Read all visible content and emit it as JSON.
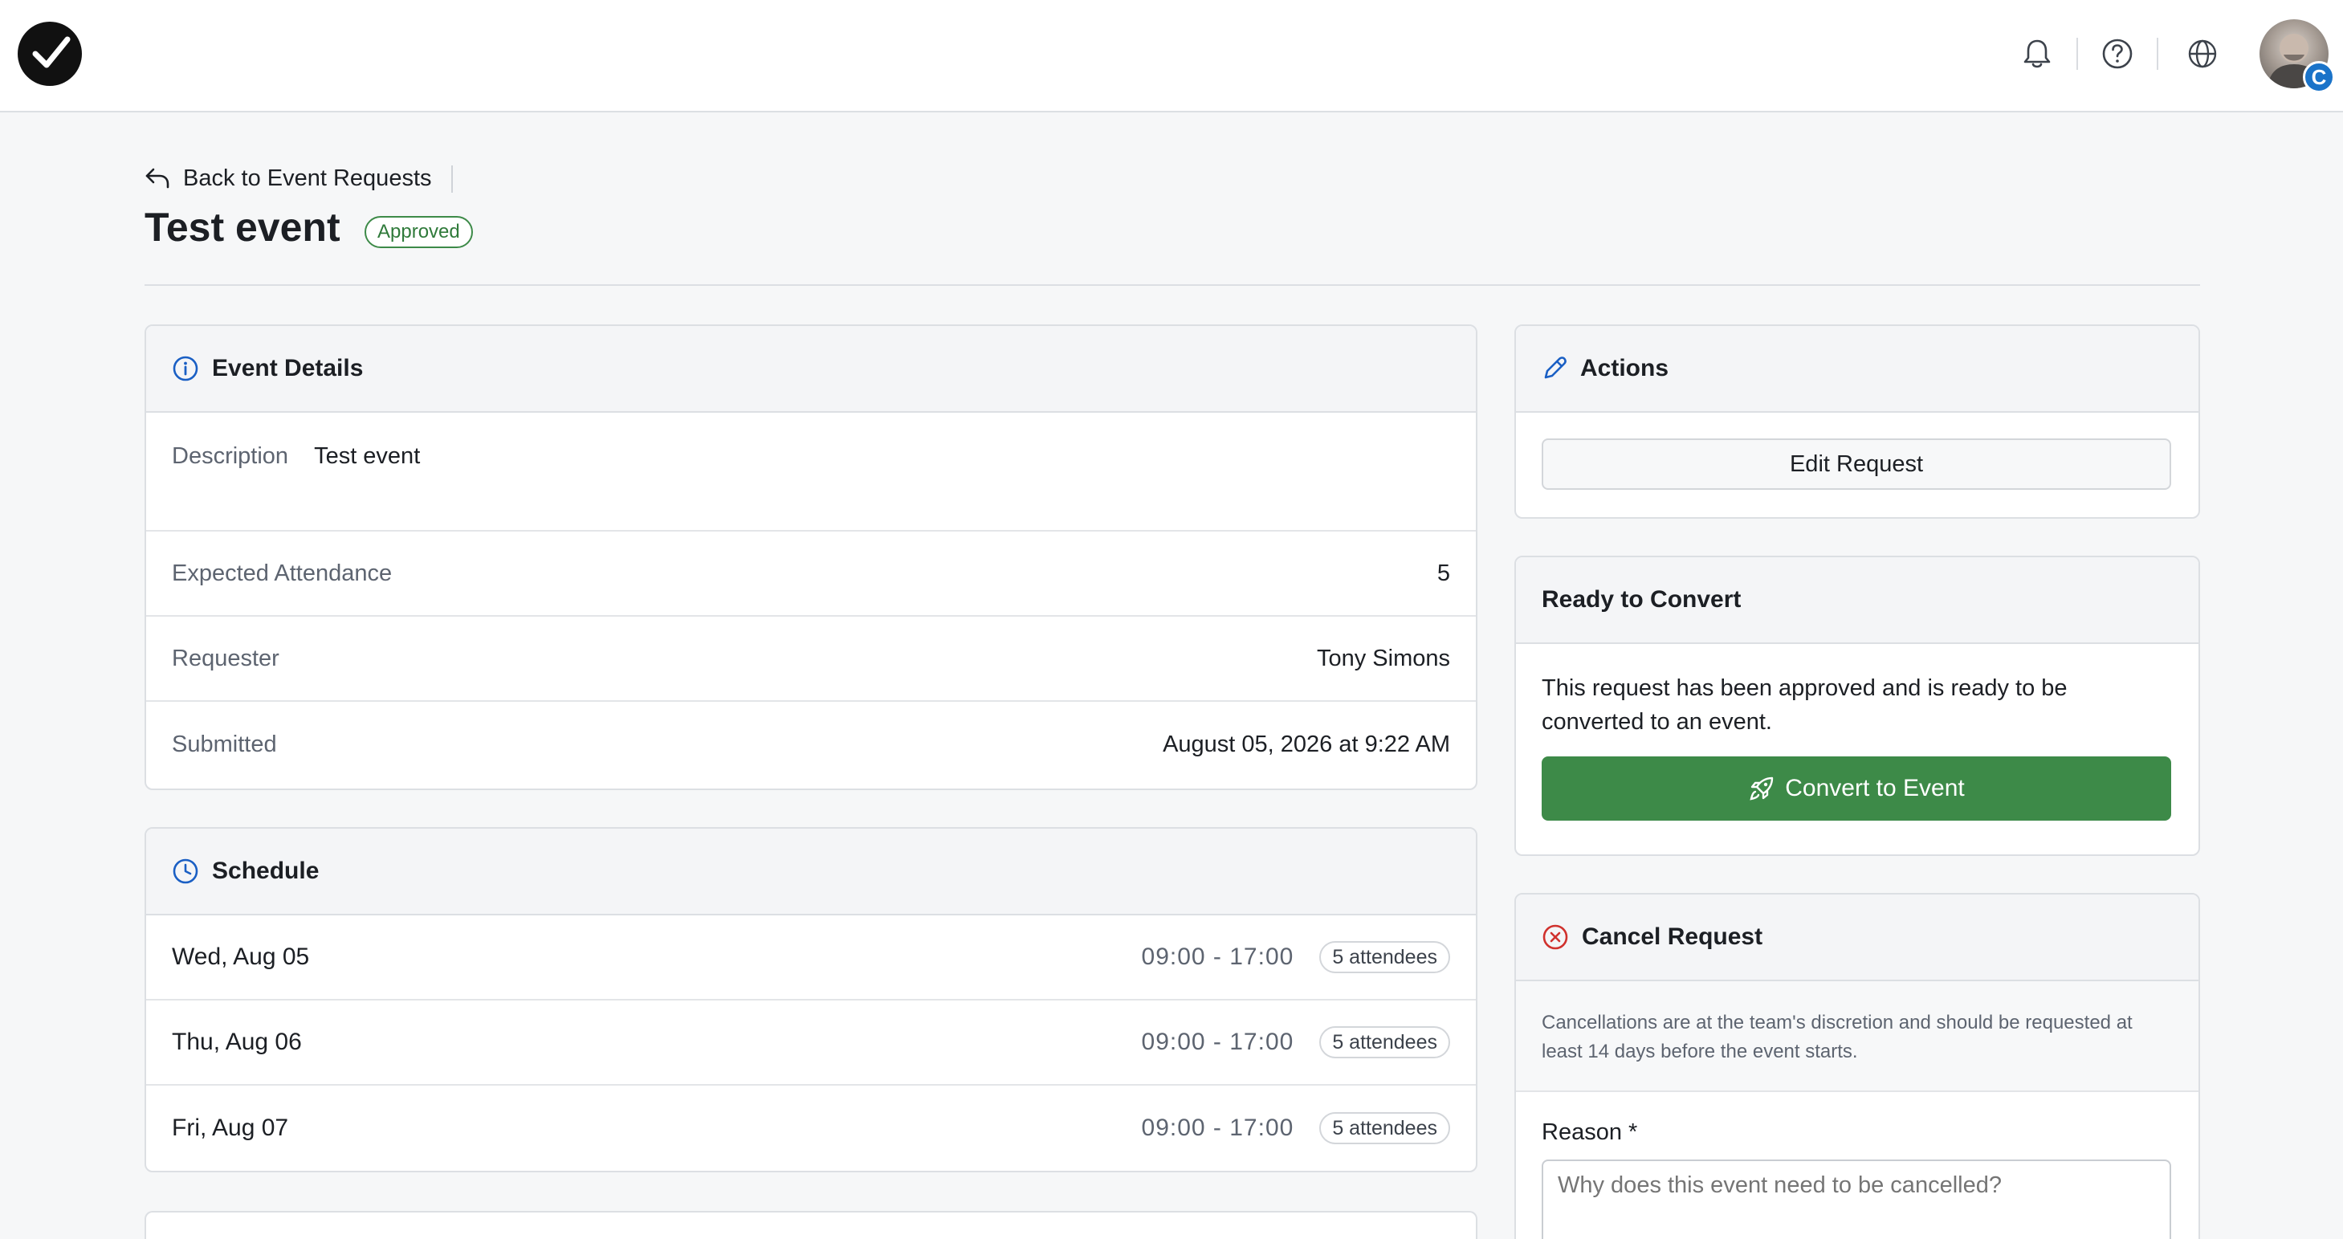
{
  "topbar": {
    "logo_icon": "check-circle-logo",
    "icons": [
      "bell-icon",
      "help-icon",
      "globe-icon"
    ],
    "avatar_badge": "C"
  },
  "header": {
    "back_label": "Back to Event Requests",
    "title": "Test event",
    "status": "Approved"
  },
  "event_details": {
    "title": "Event Details",
    "description_label": "Description",
    "description_value": "Test event",
    "rows": [
      {
        "label": "Expected Attendance",
        "value": "5"
      },
      {
        "label": "Requester",
        "value": "Tony Simons"
      },
      {
        "label": "Submitted",
        "value": "August 05, 2026 at 9:22 AM"
      }
    ]
  },
  "schedule": {
    "title": "Schedule",
    "items": [
      {
        "date": "Wed, Aug 05",
        "time": "09:00 - 17:00",
        "attendees": "5 attendees"
      },
      {
        "date": "Thu, Aug 06",
        "time": "09:00 - 17:00",
        "attendees": "5 attendees"
      },
      {
        "date": "Fri, Aug 07",
        "time": "09:00 - 17:00",
        "attendees": "5 attendees"
      }
    ]
  },
  "actions": {
    "title": "Actions",
    "edit_label": "Edit Request"
  },
  "convert": {
    "title": "Ready to Convert",
    "text": "This request has been approved and is ready to be converted to an event.",
    "button_label": "Convert to Event"
  },
  "cancel": {
    "title": "Cancel Request",
    "text": "Cancellations are at the team's discretion and should be requested at least 14 days before the event starts.",
    "reason_label": "Reason *",
    "reason_placeholder": "Why does this event need to be cancelled?"
  },
  "colors": {
    "accent_blue": "#1a5fc4",
    "success_green": "#3d8a48",
    "danger_red": "#d0312d"
  }
}
